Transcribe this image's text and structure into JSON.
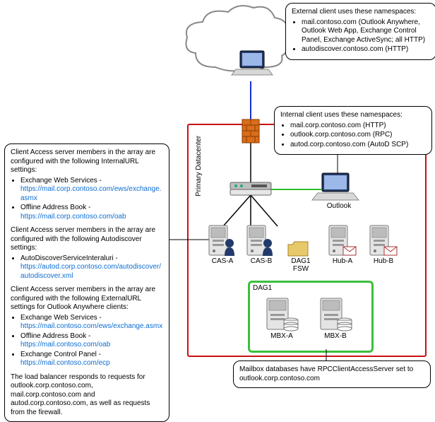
{
  "datacenter_label": "Primary Datacenter",
  "dag_label": "DAG1",
  "nodes": {
    "external_client": "",
    "firewall": "",
    "loadbalancer": "",
    "outlook": "Outlook",
    "cas_a": "CAS-A",
    "cas_b": "CAS-B",
    "dag_fsw": "DAG1\nFSW",
    "hub_a": "Hub-A",
    "hub_b": "Hub-B",
    "mbx_a": "MBX-A",
    "mbx_b": "MBX-B"
  },
  "callouts": {
    "external": {
      "intro": "External client uses these namespaces:",
      "items": [
        "mail.contoso.com (Outlook Anywhere, Outlook Web App, Exchange Control Panel, Exchange ActiveSync; all HTTP)",
        "autodiscover.contoso.com (HTTP)"
      ]
    },
    "internal": {
      "intro": "Internal client uses these namespaces:",
      "items": [
        "mail.corp.contoso.com (HTTP)",
        "outlook.corp.contoso.com (RPC)",
        "autod.corp.contoso.com (AutoD SCP)"
      ]
    },
    "cas_settings": {
      "para1": "Client Access server members in the array are configured with the following InternalURL settings:",
      "p1_items": [
        {
          "label": "Exchange Web Services -",
          "url": "https://mail.corp.contoso.com/ews/exchange.asmx"
        },
        {
          "label": "Offline Address Book -",
          "url": "https://mail.corp.contoso.com/oab"
        }
      ],
      "para2": "Client Access server members in the array are configured with the following Autodiscover settings:",
      "p2_items": [
        {
          "label": "AutoDiscoverServiceInteraluri -",
          "url": "https://autod.corp.contoso.com/autodiscover/autodiscover.xml"
        }
      ],
      "para3": "Client Access server members in the array are configured with the following ExternalURL settings for Outlook Anywhere clients:",
      "p3_items": [
        {
          "label": "Exchange Web Services -",
          "url": "https://mail.contoso.com/ews/exchange.asmx"
        },
        {
          "label": "Offline Address Book -",
          "url": "https://mail.contoso.com/oab"
        },
        {
          "label": "Exchange Control Panel -",
          "url": "https://mail.contoso.com/ecp"
        }
      ],
      "para4": "The load balancer responds to requests for outlook.corp.contoso.com, mail.corp.contoso.com and autod.corp.contoso.com, as well as requests from the firewall."
    },
    "mailbox": {
      "text": "Mailbox databases have RPCClientAccessServer set to outlook.corp.contoso.com"
    }
  }
}
